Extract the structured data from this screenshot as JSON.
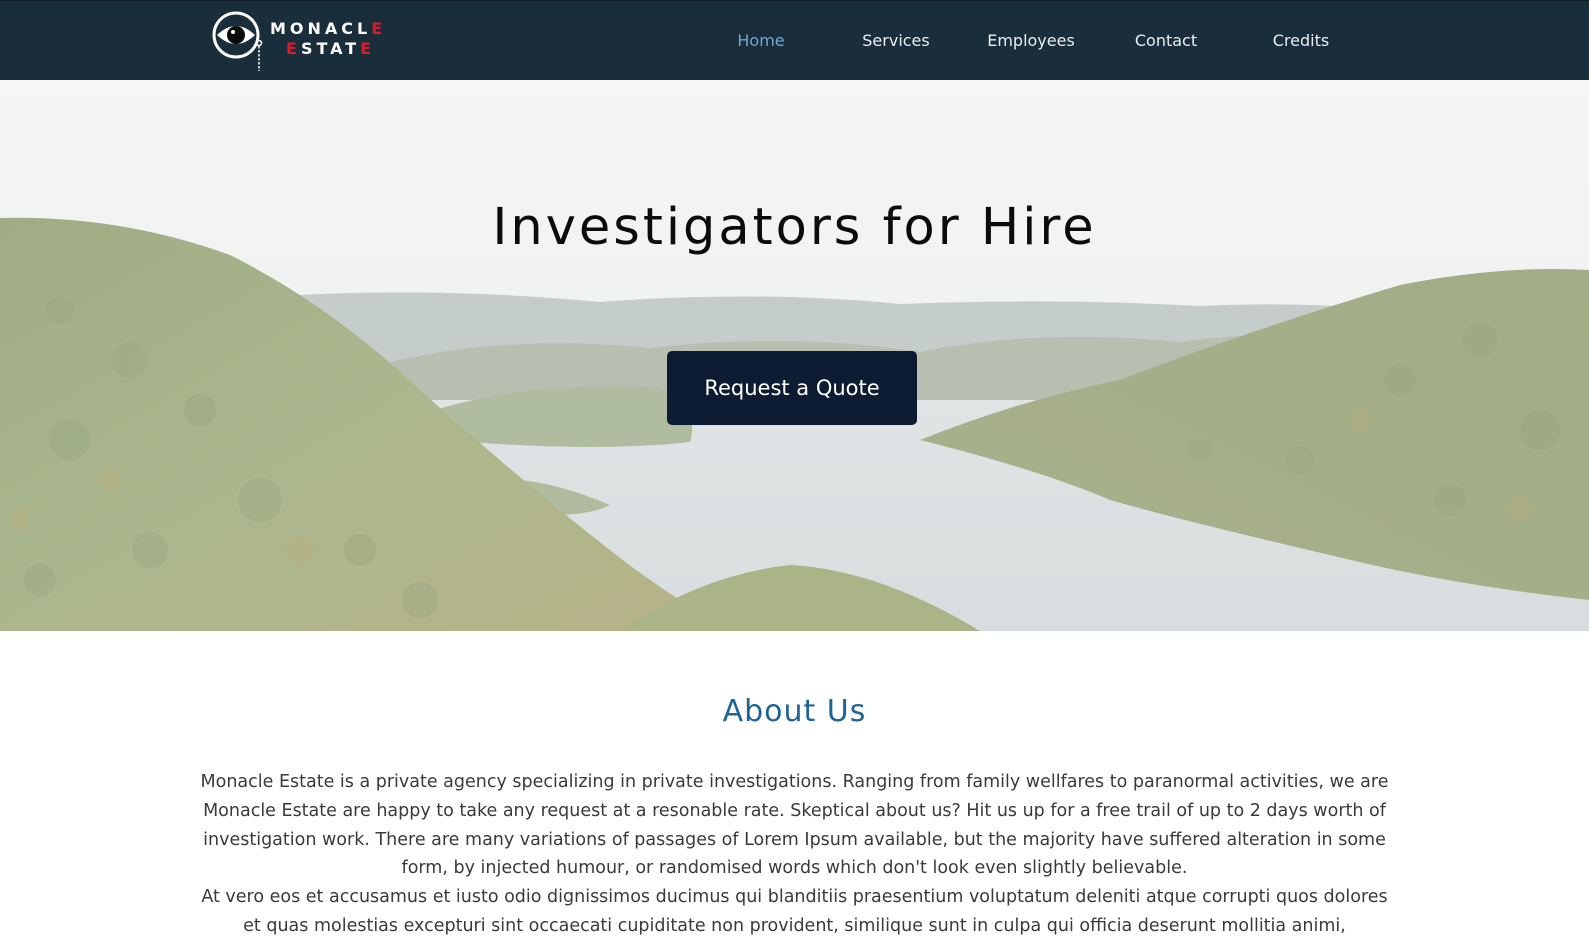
{
  "brand": {
    "line1_main": "MONACL",
    "line1_accent": "E",
    "line2_accent_start": "E",
    "line2_main": "STAT",
    "line2_accent_end": "E",
    "accent_color": "#d11f2b"
  },
  "nav": {
    "items": [
      {
        "label": "Home",
        "active": true
      },
      {
        "label": "Services",
        "active": false
      },
      {
        "label": "Employees",
        "active": false
      },
      {
        "label": "Contact",
        "active": false
      },
      {
        "label": "Credits",
        "active": false
      }
    ]
  },
  "hero": {
    "title": "Investigators for Hire",
    "cta_label": "Request a Quote"
  },
  "about": {
    "title": "About Us",
    "paragraph1": "Monacle Estate is a private agency specializing in private investigations. Ranging from family wellfares to paranormal activities, we are Monacle Estate are happy to take any request at a resonable rate. Skeptical about us? Hit us up for a free trail of up to 2 days worth of investigation work. There are many variations of passages of Lorem Ipsum available, but the majority have suffered alteration in some form, by injected humour, or randomised words which don't look even slightly believable.",
    "paragraph2": "At vero eos et accusamus et iusto odio dignissimos ducimus qui blanditiis praesentium voluptatum deleniti atque corrupti quos dolores et quas molestias excepturi sint occaecati cupiditate non provident, similique sunt in culpa qui officia deserunt mollitia animi,"
  },
  "colors": {
    "navbar_bg": "#1a2d3a",
    "nav_active": "#6fa9d2",
    "cta_bg": "#0d1c33",
    "about_title": "#1f6496"
  }
}
